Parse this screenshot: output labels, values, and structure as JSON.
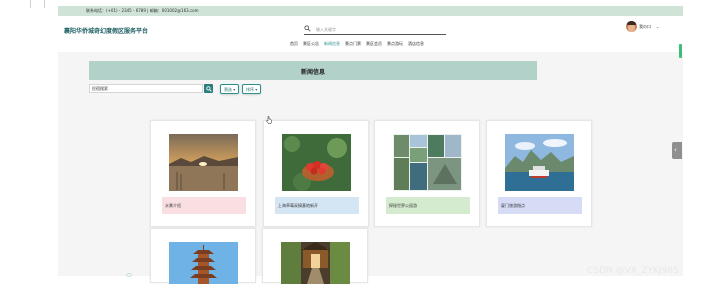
{
  "topbar": {
    "contact": "联系电话：(+01) - 2345 - 6789 | 邮箱：001002@163.com"
  },
  "header": {
    "title": "襄阳华侨城奇幻度假区服务平台"
  },
  "search": {
    "placeholder": "输入关键字"
  },
  "user": {
    "name": "我の口",
    "avatar_icon": "user-avatar-icon"
  },
  "nav": {
    "items": [
      {
        "label": "首页"
      },
      {
        "label": "景区公告"
      },
      {
        "label": "新闻信息"
      },
      {
        "label": "景点门票"
      },
      {
        "label": "景区会员"
      },
      {
        "label": "景点游玩"
      },
      {
        "label": "酒店信息"
      }
    ],
    "active_index": 2
  },
  "main": {
    "section_title": "新闻信息",
    "filter_value": "民宿搜索",
    "filter_dropdown": "筛选 ▾",
    "sort_dropdown": "排序 ▾"
  },
  "cards": [
    {
      "label": "水景介绍",
      "label_color": "#f9dfe2",
      "image": "sunset-lake"
    },
    {
      "label": "上海草莓采摘基地新开",
      "label_color": "#d4e5f4",
      "image": "strawberries"
    },
    {
      "label": "探秘世界公园游",
      "label_color": "#d4ebcf",
      "image": "scenic-collage"
    },
    {
      "label": "厦门旅游指点",
      "label_color": "#d6dcf6",
      "image": "harbor-mountains"
    },
    {
      "label": "",
      "image": "pagoda"
    },
    {
      "label": "",
      "image": "forest-path"
    }
  ],
  "watermark": "CSDN @VX_ZYKJ985",
  "colors": {
    "accent": "#2a8f8f",
    "band": "#b2d1c9",
    "topbar": "#cfe3d6"
  }
}
